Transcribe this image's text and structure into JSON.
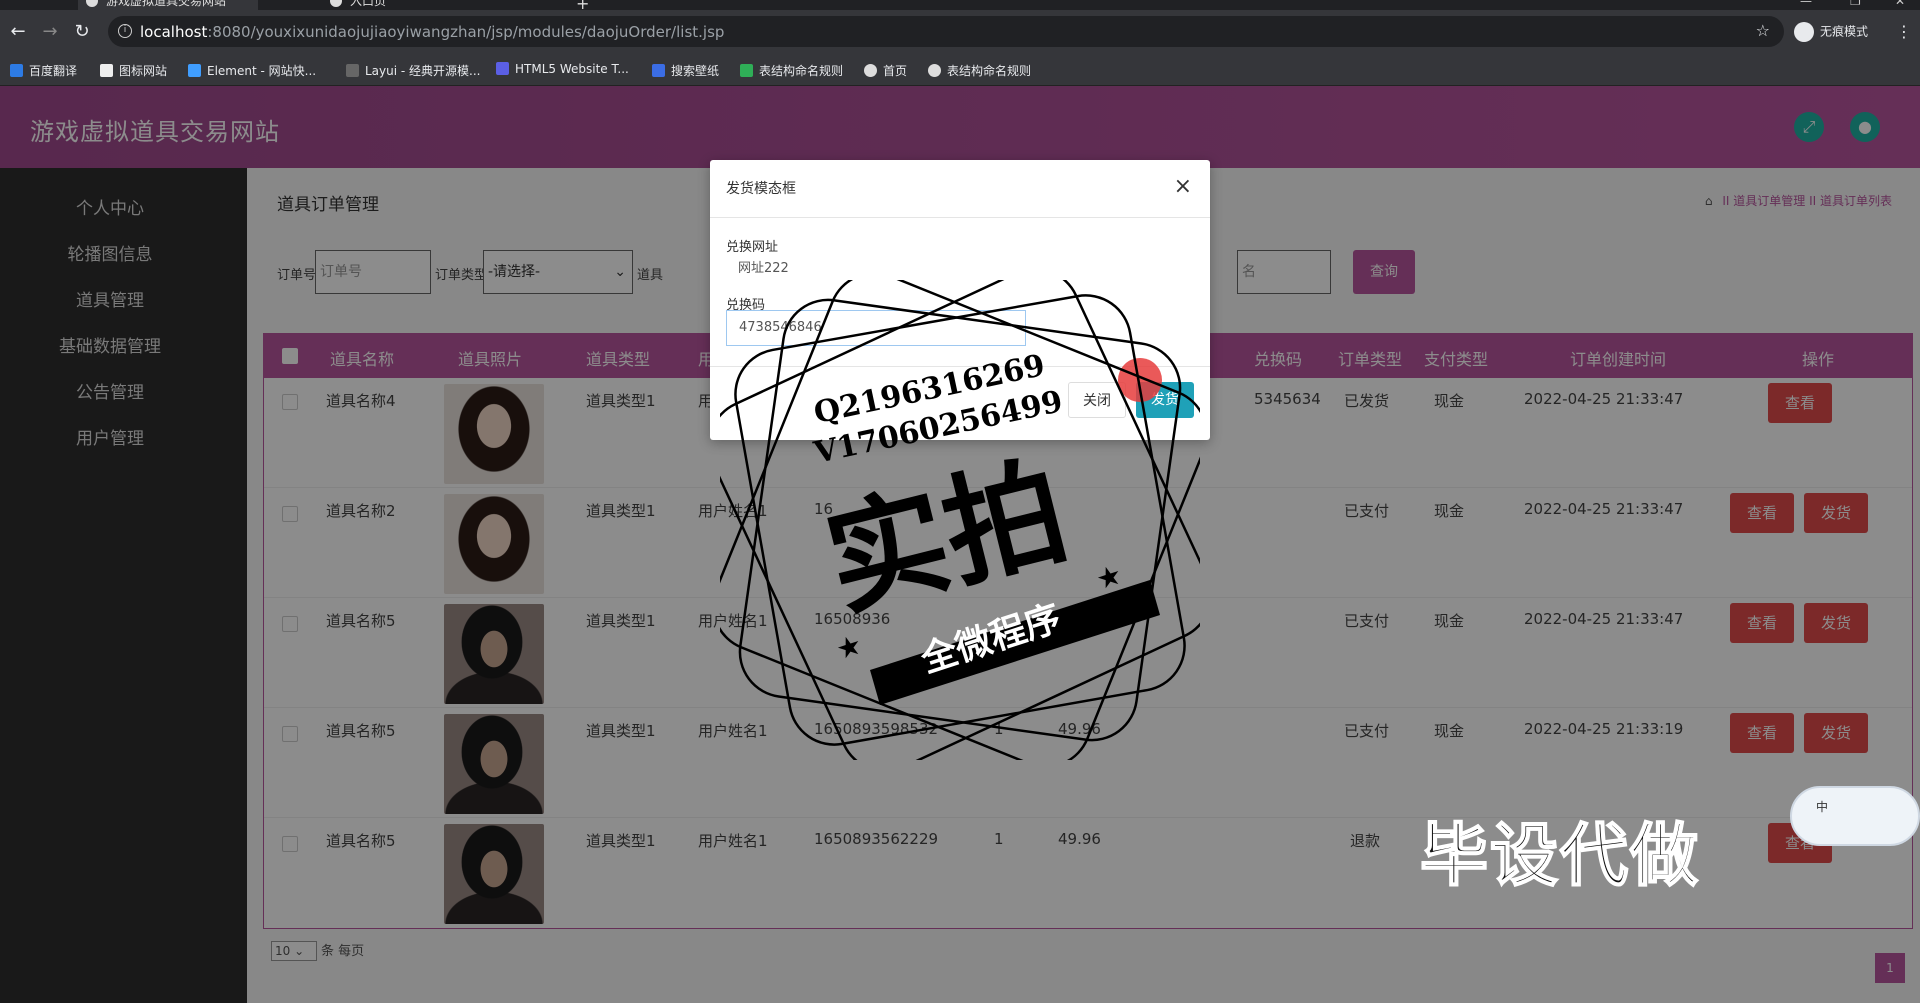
{
  "browser": {
    "tabs": [
      {
        "title": "游戏虚拟道具交易网站",
        "active": true
      },
      {
        "title": "入口页",
        "active": false
      }
    ],
    "url_host": "localhost",
    "url_path": ":8080/youxixunidaojujiaoyiwangzhan/jsp/modules/daojuOrder/list.jsp",
    "incognito_label": "无痕模式",
    "bookmarks": [
      "百度翻译",
      "图标网站",
      "Element - 网站快...",
      "Layui - 经典开源模...",
      "HTML5 Website T...",
      "搜索壁纸",
      "表结构命名规则",
      "首页",
      "表结构命名规则"
    ]
  },
  "app": {
    "brand": "游戏虚拟道具交易网站",
    "accent": "#b9569f",
    "sidebar": {
      "items": [
        "个人中心",
        "轮播图信息",
        "道具管理",
        "基础数据管理",
        "公告管理",
        "用户管理"
      ]
    },
    "page_title": "道具订单管理",
    "breadcrumb": {
      "level1": "道具订单管理",
      "sep": "II",
      "level2": "道具订单列表"
    },
    "search": {
      "order_no_label": "订单号",
      "order_no_placeholder": "订单号",
      "order_type_label": "订单类型",
      "order_type_value": "-请选择-",
      "item_label": "道具",
      "name_placeholder": "名",
      "query_button": "查询"
    },
    "table": {
      "headers": [
        "道具名称",
        "道具照片",
        "道具类型",
        "用",
        "兑换码",
        "订单类型",
        "支付类型",
        "订单创建时间",
        "操作"
      ],
      "rows": [
        {
          "name": "道具名称4",
          "photo": "woman",
          "type": "道具类型1",
          "user": "用",
          "order_no": "",
          "qty": "",
          "price": "",
          "code": "5345634",
          "order_type": "已发货",
          "pay": "现金",
          "time": "2022-04-25 21:33:47",
          "actions": [
            "查看"
          ]
        },
        {
          "name": "道具名称2",
          "photo": "woman",
          "type": "道具类型1",
          "user": "用户姓名1",
          "order_no": "16",
          "qty": "",
          "price": "",
          "code": "",
          "order_type": "已支付",
          "pay": "现金",
          "time": "2022-04-25 21:33:47",
          "actions": [
            "查看",
            "发货"
          ]
        },
        {
          "name": "道具名称5",
          "photo": "man",
          "type": "道具类型1",
          "user": "用户姓名1",
          "order_no": "16508936",
          "qty": "",
          "price": "",
          "code": "",
          "order_type": "已支付",
          "pay": "现金",
          "time": "2022-04-25 21:33:47",
          "actions": [
            "查看",
            "发货"
          ]
        },
        {
          "name": "道具名称5",
          "photo": "man",
          "type": "道具类型1",
          "user": "用户姓名1",
          "order_no": "1650893598532",
          "qty": "1",
          "price": "49.96",
          "code": "",
          "order_type": "已支付",
          "pay": "现金",
          "time": "2022-04-25 21:33:19",
          "actions": [
            "查看",
            "发货"
          ]
        },
        {
          "name": "道具名称5",
          "photo": "man",
          "type": "道具类型1",
          "user": "用户姓名1",
          "order_no": "1650893562229",
          "qty": "1",
          "price": "49.96",
          "code": "",
          "order_type": "退款",
          "pay": "",
          "time": "",
          "actions": [
            "查看"
          ]
        }
      ]
    },
    "pager": {
      "per_page": "10",
      "per_page_label": "条 每页",
      "current": "1"
    }
  },
  "modal": {
    "title": "发货模态框",
    "close_icon": "×",
    "field1_label": "兑换网址",
    "field1_value": "网址222",
    "field2_label": "兑换码",
    "field2_value": "4738546846",
    "close_button": "关闭",
    "ship_button": "发货"
  },
  "watermark": {
    "qq": "Q2196316269",
    "v": "V17060256499",
    "big": "实拍",
    "banner": "全微程序",
    "corner": "毕设代做",
    "widget": "中"
  }
}
